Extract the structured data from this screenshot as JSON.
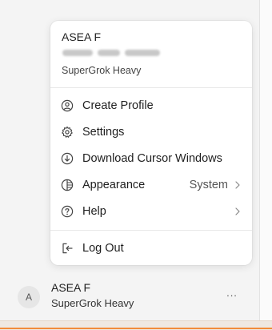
{
  "menu": {
    "user_name": "ASEA F",
    "plan": "SuperGrok Heavy",
    "items": [
      {
        "label": "Create Profile",
        "icon": "user-circle-icon"
      },
      {
        "label": "Settings",
        "icon": "gear-icon"
      },
      {
        "label": "Download Cursor Windows",
        "icon": "download-circle-icon"
      },
      {
        "label": "Appearance",
        "icon": "appearance-icon",
        "value": "System"
      },
      {
        "label": "Help",
        "icon": "help-circle-icon"
      },
      {
        "label": "Log Out",
        "icon": "logout-icon"
      }
    ]
  },
  "account": {
    "initial": "A",
    "name": "ASEA F",
    "plan": "SuperGrok Heavy",
    "more": "..."
  },
  "colors": {
    "accent_bottom": "#f28c3a",
    "menu_bg": "#ffffff",
    "page_bg": "#f4f4f4"
  }
}
